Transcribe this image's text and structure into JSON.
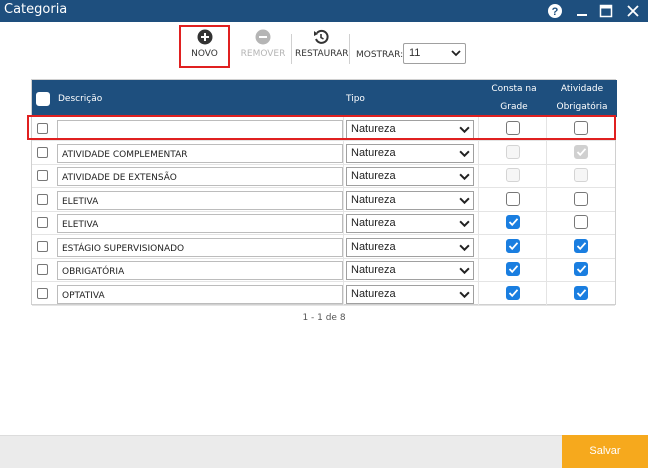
{
  "window": {
    "title": "Categoria"
  },
  "toolbar": {
    "novo": "NOVO",
    "remover": "REMOVER",
    "restaurar": "RESTAURAR",
    "mostrar_label": "MOSTRAR:",
    "mostrar_value": "11"
  },
  "table": {
    "headers": {
      "descricao": "Descrição",
      "tipo": "Tipo",
      "consta_line1": "Consta na",
      "consta_line2": "Grade",
      "atividade_line1": "Atividade",
      "atividade_line2": "Obrigatória"
    },
    "rows": [
      {
        "descricao": "",
        "tipo": "Natureza",
        "consta": false,
        "obrigatoria": false,
        "disabled": false
      },
      {
        "descricao": "ATIVIDADE COMPLEMENTAR",
        "tipo": "Natureza",
        "consta": false,
        "obrigatoria": true,
        "disabled": true
      },
      {
        "descricao": "ATIVIDADE DE EXTENSÃO",
        "tipo": "Natureza",
        "consta": false,
        "obrigatoria": false,
        "disabled": true
      },
      {
        "descricao": "ELETIVA",
        "tipo": "Natureza",
        "consta": false,
        "obrigatoria": false,
        "disabled": false
      },
      {
        "descricao": "ELETIVA",
        "tipo": "Natureza",
        "consta": true,
        "obrigatoria": false,
        "disabled": false
      },
      {
        "descricao": "ESTÁGIO SUPERVISIONADO",
        "tipo": "Natureza",
        "consta": true,
        "obrigatoria": true,
        "disabled": false
      },
      {
        "descricao": "OBRIGATÓRIA",
        "tipo": "Natureza",
        "consta": true,
        "obrigatoria": true,
        "disabled": false
      },
      {
        "descricao": "OPTATIVA",
        "tipo": "Natureza",
        "consta": true,
        "obrigatoria": true,
        "disabled": false
      }
    ]
  },
  "pagination": {
    "text": "1 - 1 de 8"
  },
  "footer": {
    "salvar": "Salvar"
  },
  "colors": {
    "header_bg": "#1e4f7e",
    "checked": "#1a7ee0",
    "save_button": "#f6a91d",
    "highlight": "#e02020"
  }
}
